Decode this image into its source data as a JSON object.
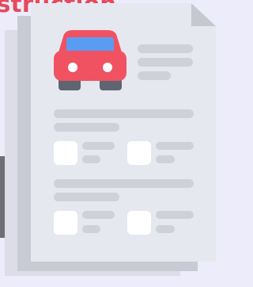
{
  "headline": {
    "text": "struction."
  },
  "illustration": {
    "icon": "car-document-icon",
    "colors": {
      "background": "#ececfb",
      "sheet_back": "#dddde8",
      "sheet_mid": "#c9cbd4",
      "sheet_front": "#e6e8ef",
      "dog_ear": "#c5c8d1",
      "placeholder_line": "#ced1d8",
      "checkbox": "#ffffff",
      "car_body": "#f05262",
      "car_window": "#5a9cf2",
      "car_wheels": "#5e6470",
      "car_lights": "#ffffff",
      "headline_red": "#e54a5b",
      "edge_strip": "#6d6f75"
    }
  }
}
